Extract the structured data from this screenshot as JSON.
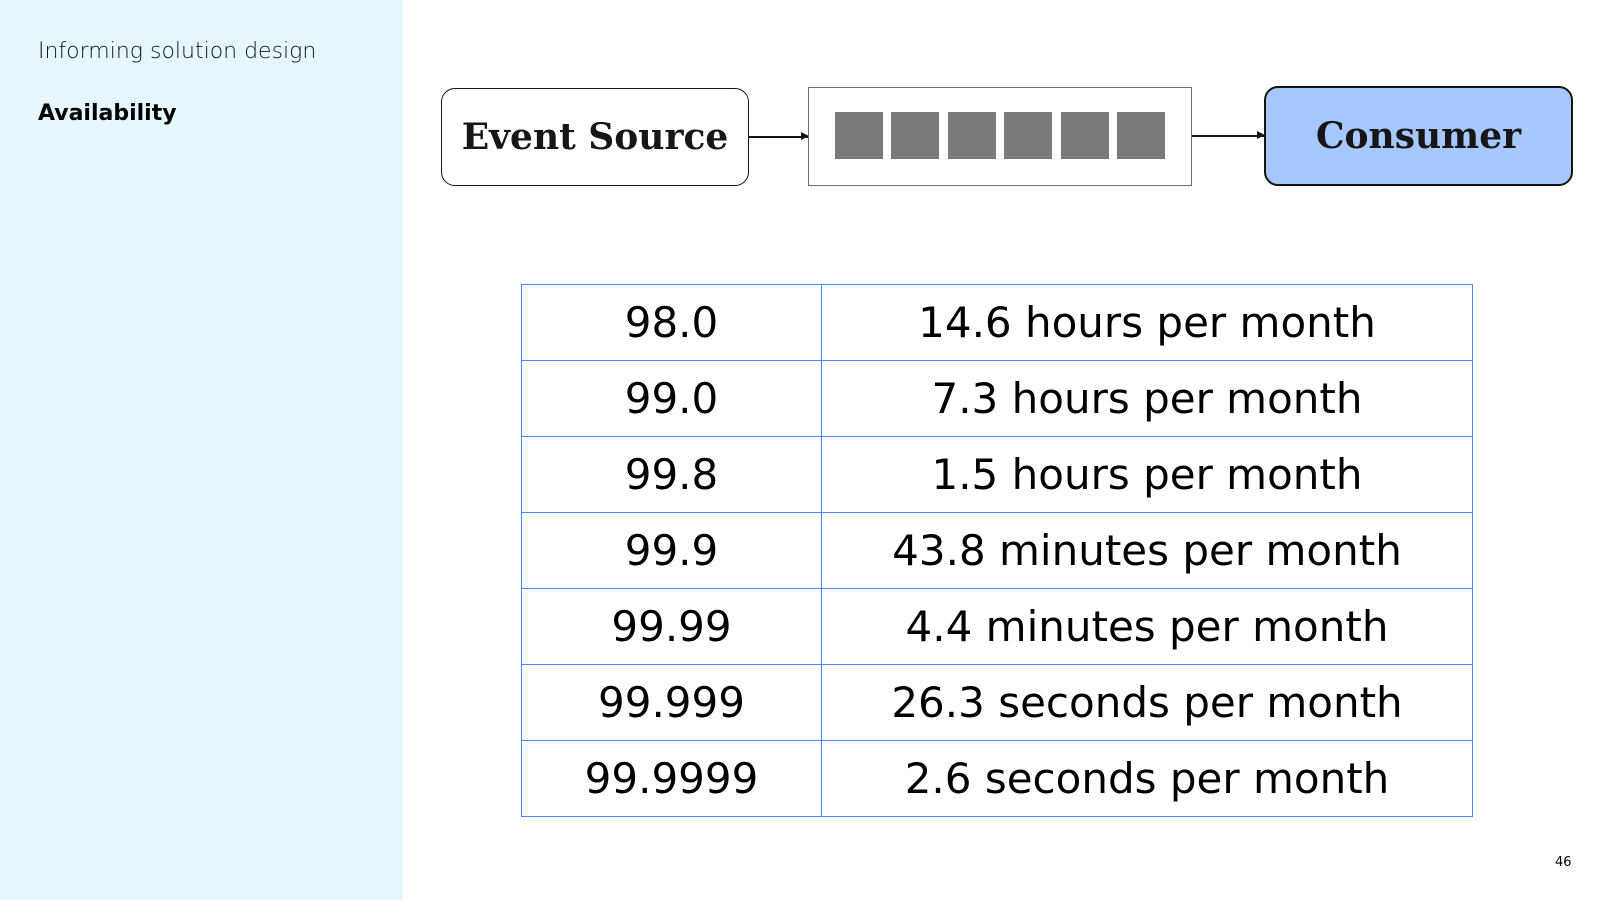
{
  "sidebar": {
    "section_title": "Informing solution design",
    "heading": "Availability"
  },
  "diagram": {
    "source_label": "Event Source",
    "consumer_label": "Consumer",
    "queue_cell_count": 6,
    "colors": {
      "consumer_fill": "#a6c8ff",
      "queue_cell": "#7a7a7a"
    }
  },
  "table": {
    "rows": [
      {
        "availability": "98.0",
        "downtime": "14.6 hours per month"
      },
      {
        "availability": "99.0",
        "downtime": "7.3 hours per month"
      },
      {
        "availability": "99.8",
        "downtime": "1.5 hours per month"
      },
      {
        "availability": "99.9",
        "downtime": "43.8 minutes per month"
      },
      {
        "availability": "99.99",
        "downtime": "4.4 minutes per month"
      },
      {
        "availability": "99.999",
        "downtime": "26.3 seconds per month"
      },
      {
        "availability": "99.9999",
        "downtime": "2.6 seconds per month"
      }
    ],
    "border_color": "#4589ff"
  },
  "page_number": "46",
  "colors": {
    "sidebar_background": "#e5f6ff"
  }
}
